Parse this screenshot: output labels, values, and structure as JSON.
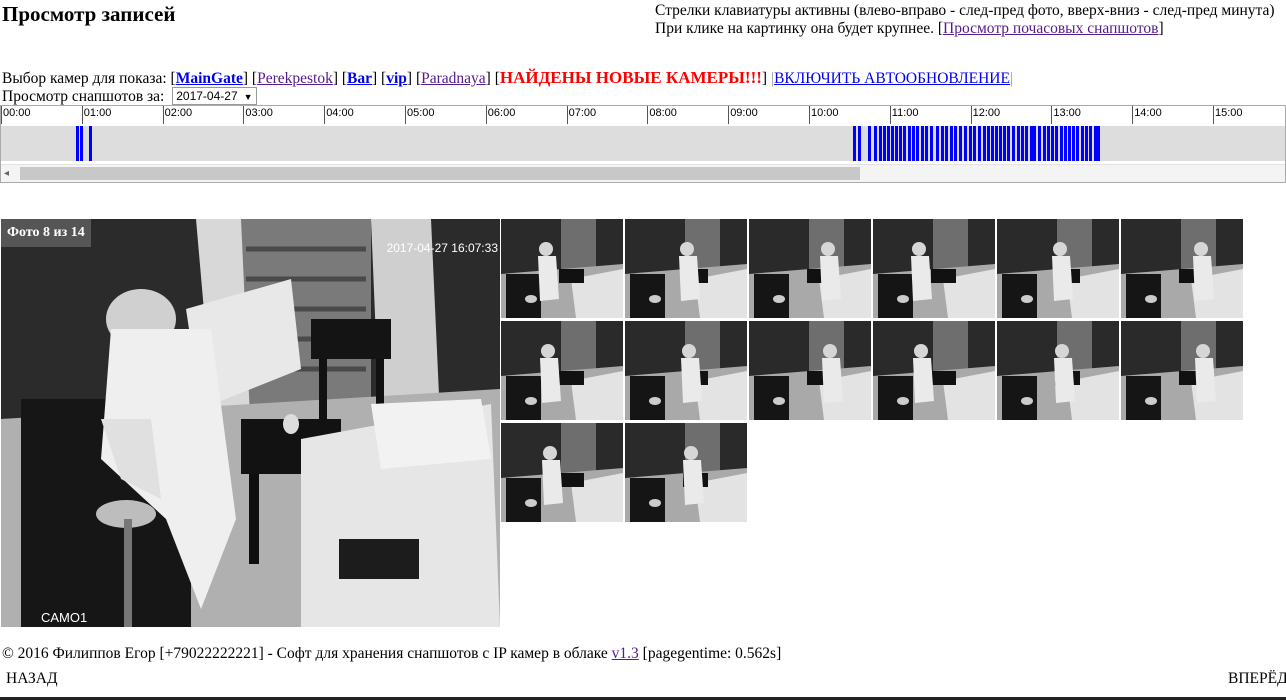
{
  "page": {
    "title": "Просмотр записей",
    "help_line1": "Стрелки клавиатуры активны (влево-вправо - след-пред фото, вверх-вниз - след-пред минута)",
    "help_line2_prefix": "При клике на картинку она будет крупнее. [",
    "help_link": "Просмотр почасовых снапшотов",
    "help_line2_suffix": "]"
  },
  "cameras": {
    "label": "Выбор камер для показа:",
    "items": [
      {
        "name": "MainGate",
        "selected": true
      },
      {
        "name": "Perekpestok",
        "selected": false
      },
      {
        "name": "Bar",
        "selected": true
      },
      {
        "name": "vip",
        "selected": true
      },
      {
        "name": "Paradnaya",
        "selected": false
      }
    ],
    "new_cameras_text": "НАЙДЕНЫ НОВЫЕ КАМЕРЫ!!!",
    "autoupdate_text": "ВКЛЮЧИТЬ АВТООБНОВЛЕНИЕ"
  },
  "snapshots": {
    "label": "Просмотр снапшотов за:",
    "date_value": "2017-04-27"
  },
  "timeline": {
    "hours": [
      "00:00",
      "01:00",
      "02:00",
      "03:00",
      "04:00",
      "05:00",
      "06:00",
      "07:00",
      "08:00",
      "09:00",
      "10:00",
      "11:00",
      "12:00",
      "13:00",
      "14:00",
      "15:00"
    ],
    "marks_hours": [
      0.46,
      0.51,
      0.62,
      10.07,
      10.14,
      10.26,
      10.34,
      10.39,
      10.44,
      10.49,
      10.54,
      10.59,
      10.64,
      10.69,
      10.75,
      10.8,
      10.86,
      10.92,
      10.97,
      11.03,
      11.1,
      11.16,
      11.21,
      11.27,
      11.33,
      11.38,
      11.45,
      11.51,
      11.56,
      11.62,
      11.68,
      11.73,
      11.78,
      11.83,
      11.88,
      11.93,
      11.98,
      12.04,
      12.1,
      12.15,
      12.2,
      12.26,
      12.3,
      12.36,
      12.42,
      12.47,
      12.52,
      12.58,
      12.64,
      12.69,
      12.74,
      12.79,
      12.84,
      12.9,
      12.95,
      13.0,
      13.06,
      13.1
    ]
  },
  "photo": {
    "counter": "Фото 8 из 14",
    "timestamp": "2017-04-27 16:07:33",
    "camera_overlay": "CAMO1"
  },
  "thumbnails": {
    "count": 14,
    "per_row": 6
  },
  "footer": {
    "text": "© 2016 Филиппов Егор [+79022222221] - Софт для хранения снапшотов с IP камер в облаке ",
    "version_link": "v1.3",
    "pagegentime": " [pagegentime: 0.562s]"
  },
  "nav": {
    "back": "НАЗАД",
    "forward": "ВПЕРЁД"
  },
  "colors": {
    "link": "#0000ee",
    "visited": "#551a8b",
    "timeline_mark": "#0000ff",
    "alert": "#ff0000"
  }
}
